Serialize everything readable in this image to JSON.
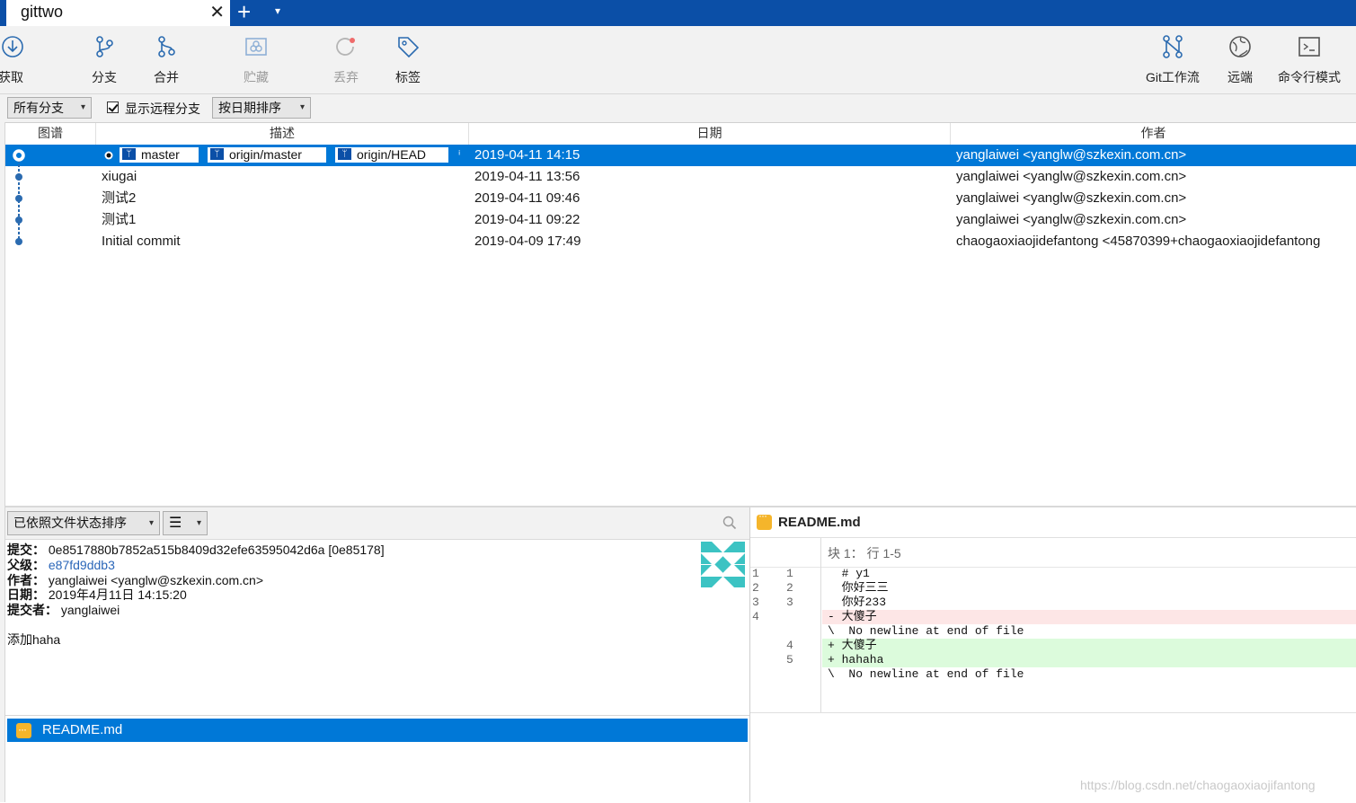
{
  "tab": {
    "title": "gittwo",
    "close": "✕",
    "new_tab": "+",
    "dropdown": "▾"
  },
  "toolbar": {
    "fetch": "获取",
    "branch": "分支",
    "merge": "合并",
    "stash": "贮藏",
    "discard": "丢弃",
    "tag": "标签",
    "git_flow": "Git工作流",
    "remote": "远端",
    "terminal": "命令行模式"
  },
  "filters": {
    "branches": "所有分支",
    "show_remote": "显示远程分支",
    "sort": "按日期排序"
  },
  "columns": {
    "graph": "图谱",
    "description": "描述",
    "date": "日期",
    "author": "作者"
  },
  "refs": [
    "master",
    "origin/master",
    "origin/HEAD"
  ],
  "commits": [
    {
      "description": "",
      "date": "2019-04-11 14:15",
      "author": "yanglaiwei <yanglw@szkexin.com.cn>"
    },
    {
      "description": "xiugai",
      "date": "2019-04-11 13:56",
      "author": "yanglaiwei <yanglw@szkexin.com.cn>"
    },
    {
      "description": "测试2",
      "date": "2019-04-11 09:46",
      "author": "yanglaiwei <yanglw@szkexin.com.cn>"
    },
    {
      "description": "测试1",
      "date": "2019-04-11 09:22",
      "author": "yanglaiwei <yanglw@szkexin.com.cn>"
    },
    {
      "description": "Initial commit",
      "date": "2019-04-09 17:49",
      "author": "chaogaoxiaojidefantong <45870399+chaogaoxiaojidefantong"
    }
  ],
  "file_sort": "已依照文件状态排序",
  "details": {
    "commit_label": "提交：",
    "commit_value": "0e8517880b7852a515b8409d32efe63595042d6a [0e85178]",
    "parent_label": "父级：",
    "parent_value": "e87fd9ddb3",
    "author_label": "作者：",
    "author_value": "yanglaiwei <yanglw@szkexin.com.cn>",
    "date_label": "日期：",
    "date_value": "2019年4月11日 14:15:20",
    "committer_label": "提交者：",
    "committer_value": "yanglaiwei",
    "message": "添加haha"
  },
  "files": [
    {
      "name": "README.md",
      "status_icon": "modified-icon"
    }
  ],
  "diff": {
    "file": "README.md",
    "hunk_header": "块 1： 行 1-5",
    "lines": [
      {
        "old": "1",
        "new": "1",
        "type": "ctx",
        "text": "  # y1"
      },
      {
        "old": "2",
        "new": "2",
        "type": "ctx",
        "text": "  你好三三"
      },
      {
        "old": "3",
        "new": "3",
        "type": "ctx",
        "text": "  你好233"
      },
      {
        "old": "4",
        "new": "",
        "type": "del",
        "text": "- 大傻子"
      },
      {
        "old": "",
        "new": "",
        "type": "ctx",
        "text": "\\  No newline at end of file"
      },
      {
        "old": "",
        "new": "4",
        "type": "add",
        "text": "+ 大傻子"
      },
      {
        "old": "",
        "new": "5",
        "type": "add",
        "text": "+ hahaha"
      },
      {
        "old": "",
        "new": "",
        "type": "ctx",
        "text": "\\  No newline at end of file"
      }
    ]
  },
  "watermark": "https://blog.csdn.net/chaogaoxiaojifantong",
  "colors": {
    "accent": "#0078d7",
    "tabbar": "#0b4fa7",
    "graph": "#2b6bb0",
    "add_bg": "#dcfbdc",
    "del_bg": "#fde6e6",
    "modified": "#f5b52b"
  }
}
